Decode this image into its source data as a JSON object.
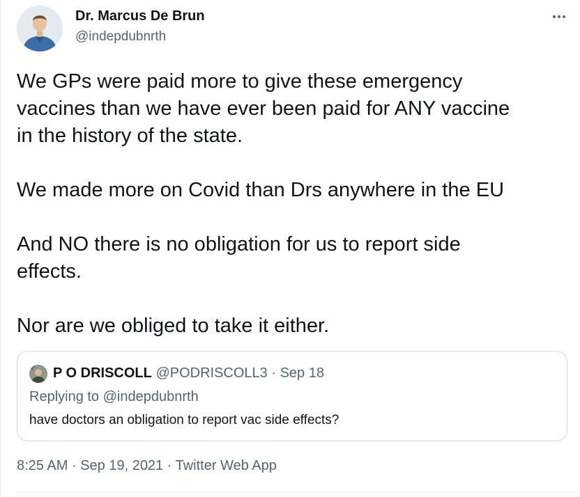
{
  "author": {
    "name": "Dr. Marcus De Brun",
    "handle": "@indepdubnrth"
  },
  "more_icon": "more-horizontal-icon",
  "tweet": {
    "paragraphs": [
      "We GPs were paid more to give these emergency\nvaccines than we have ever been paid for  ANY vaccine\nin the history of the state.",
      "We made more on Covid than Drs anywhere in the EU",
      "And NO there is no obligation for us to report side\neffects.",
      "Nor are we obliged to take it either."
    ]
  },
  "quoted_tweet": {
    "name": "P O DRISCOLL",
    "handle": "@PODRISCOLL3",
    "separator": "·",
    "date": "Sep 18",
    "replying_prefix": "Replying to ",
    "replying_to": "@indepdubnrth",
    "text": "have doctors an obligation to report vac side effects?"
  },
  "meta": {
    "time": "8:25 AM",
    "separator": "·",
    "date": "Sep 19, 2021",
    "source": "Twitter Web App"
  },
  "colors": {
    "text": "#0f1419",
    "secondary": "#536471",
    "border": "#cfd9de"
  }
}
